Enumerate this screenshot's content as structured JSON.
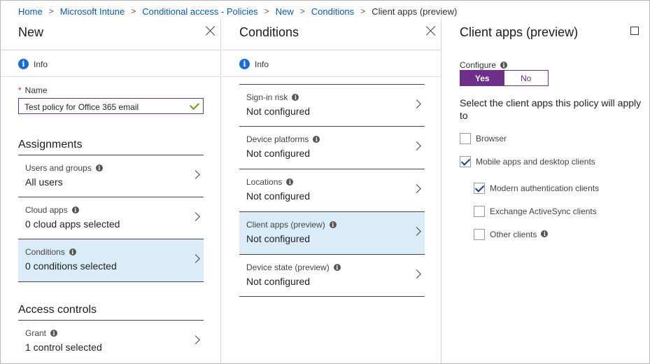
{
  "breadcrumb": {
    "links": [
      "Home",
      "Microsoft Intune",
      "Conditional access - Policies",
      "New",
      "Conditions"
    ],
    "current": "Client apps (preview)",
    "separator": ">"
  },
  "blade_new": {
    "title": "New",
    "info_label": "Info",
    "name_label": "Name",
    "name_value": "Test policy for Office 365 email",
    "assignments_title": "Assignments",
    "assignments": [
      {
        "label": "Users and groups",
        "value": "All users"
      },
      {
        "label": "Cloud apps",
        "value": "0 cloud apps selected"
      },
      {
        "label": "Conditions",
        "value": "0 conditions selected"
      }
    ],
    "access_controls_title": "Access controls",
    "grant": {
      "label": "Grant",
      "value": "1 control selected"
    }
  },
  "blade_conditions": {
    "title": "Conditions",
    "info_label": "Info",
    "items": [
      {
        "label": "Sign-in risk",
        "value": "Not configured"
      },
      {
        "label": "Device platforms",
        "value": "Not configured"
      },
      {
        "label": "Locations",
        "value": "Not configured"
      },
      {
        "label": "Client apps (preview)",
        "value": "Not configured"
      },
      {
        "label": "Device state (preview)",
        "value": "Not configured"
      }
    ]
  },
  "blade_client_apps": {
    "title": "Client apps (preview)",
    "configure_label": "Configure",
    "toggle": {
      "yes": "Yes",
      "no": "No",
      "selected": "Yes"
    },
    "description": "Select the client apps this policy will apply to",
    "options": [
      {
        "label": "Browser",
        "checked": false
      },
      {
        "label": "Mobile apps and desktop clients",
        "checked": true
      },
      {
        "label": "Modern authentication clients",
        "checked": true
      },
      {
        "label": "Exchange ActiveSync clients",
        "checked": false
      },
      {
        "label": "Other clients",
        "checked": false
      }
    ]
  },
  "colors": {
    "accent_purple": "#6d2e8c",
    "link_blue": "#0a58b0",
    "info_blue": "#1b6ad5",
    "selected_bg": "#dbecf9",
    "check_green": "#6c9d1e"
  }
}
